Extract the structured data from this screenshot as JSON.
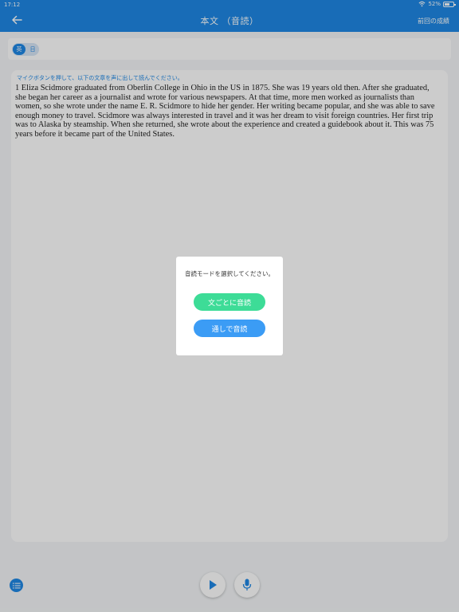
{
  "status_bar": {
    "time": "17:12",
    "battery": "52%"
  },
  "header": {
    "title": "本文 （音読）",
    "right_link": "前回の成績"
  },
  "language_toggle": {
    "options": [
      "英",
      "日"
    ],
    "selected": "英"
  },
  "content": {
    "instruction": "マイクボタンを押して、以下の文章を声に出して読んでください。",
    "passage": "1 Eliza Scidmore graduated from Oberlin College in Ohio in the US in 1875. She was 19 years old then. After she graduated, she began her career as a journalist and wrote for various newspapers. At that time, more men worked as journalists than women, so she wrote under the name E. R. Scidmore to hide her gender. Her writing became popular, and she was able to save enough money to travel. Scidmore was always interested in travel and it was her dream to visit foreign countries. Her first trip was to Alaska by steamship. When she returned, she wrote about the experience and created a guidebook about it. This was 75 years before it became part of the United States."
  },
  "dialog": {
    "message": "音読モードを選択してください。",
    "buttons": {
      "sentence": "文ごとに音読",
      "through": "通しで音読"
    }
  },
  "colors": {
    "primary": "#1e88e5",
    "green": "#3ddc97",
    "blue_btn": "#3b9cf5"
  },
  "icons": {
    "back": "arrow-left-icon",
    "play": "play-icon",
    "mic": "microphone-icon",
    "list": "list-icon"
  }
}
